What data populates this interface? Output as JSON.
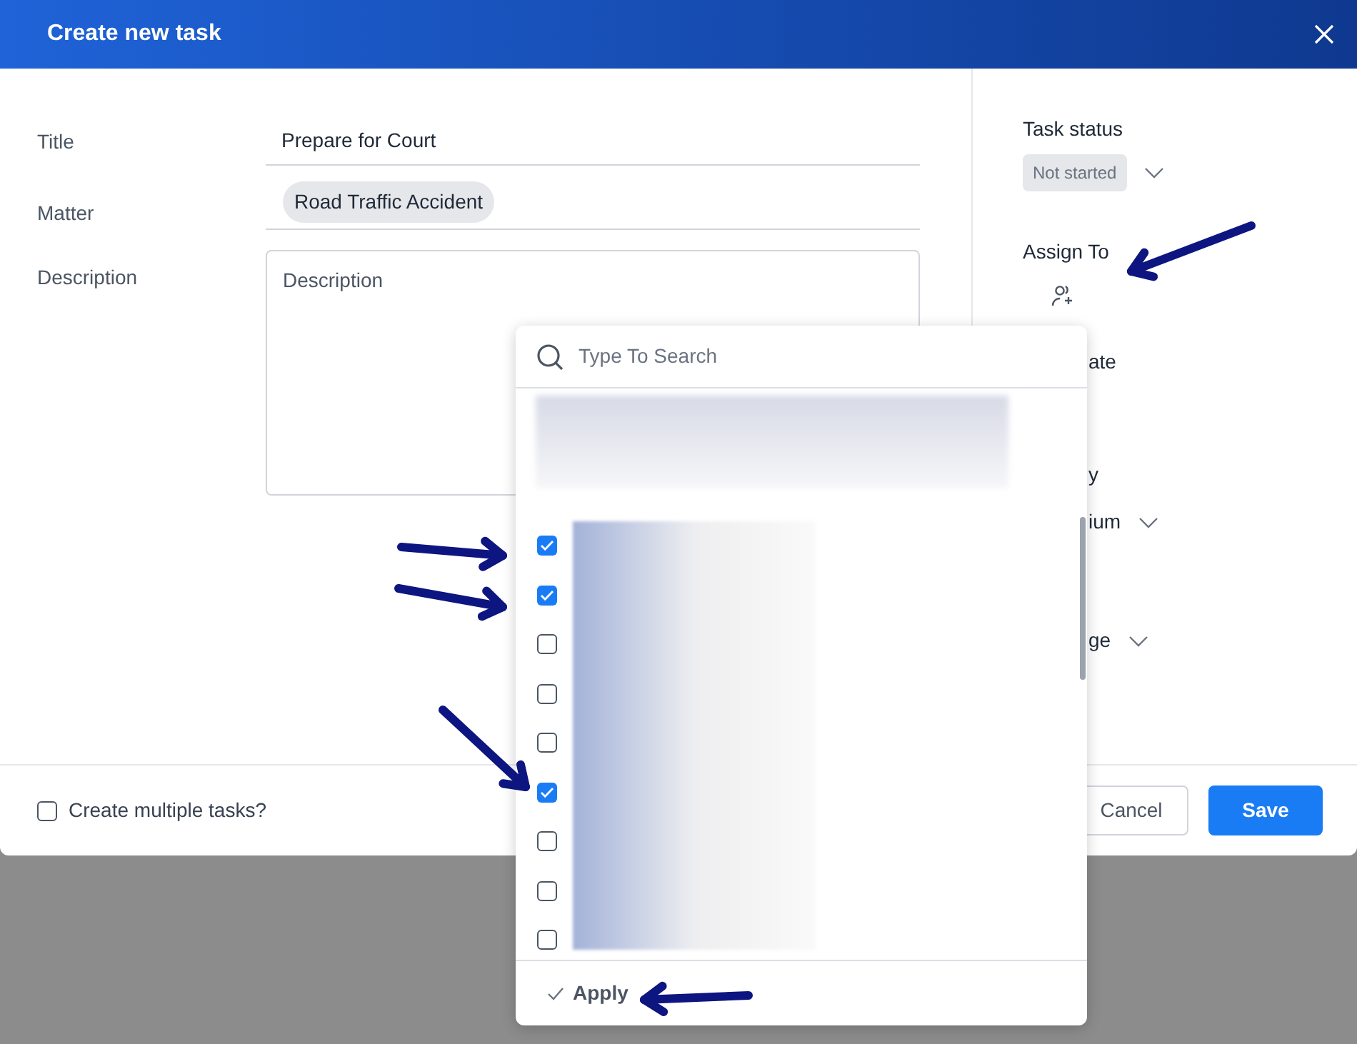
{
  "dialog": {
    "title": "Create new task"
  },
  "fields": [
    {
      "label": "Title",
      "kind": "text",
      "value": "Prepare for Court"
    },
    {
      "label": "Matter",
      "kind": "chip",
      "value": "Road Traffic Accident"
    },
    {
      "label": "Description",
      "kind": "textarea",
      "placeholder": "Description"
    }
  ],
  "side": {
    "status_label": "Task status",
    "status": "Not started",
    "assign_label": "Assign To",
    "items": [
      {
        "kind": "label",
        "text": "ate"
      },
      {
        "kind": "label",
        "text": "y"
      },
      {
        "kind": "select",
        "text": "ium"
      },
      {
        "kind": "select",
        "text": "ge"
      }
    ]
  },
  "footer": {
    "multiple": {
      "label": "Create multiple tasks?",
      "checked": false
    },
    "buttons": [
      {
        "label": "Cancel",
        "kind": "secondary"
      },
      {
        "label": "Save",
        "kind": "primary"
      }
    ]
  },
  "dropdown": {
    "placeholder": "Type To Search",
    "options": [
      {
        "checked": true
      },
      {
        "checked": true
      },
      {
        "checked": false
      },
      {
        "checked": false
      },
      {
        "checked": false
      },
      {
        "checked": true
      },
      {
        "checked": false
      },
      {
        "checked": false
      },
      {
        "checked": false
      }
    ],
    "apply": "Apply"
  }
}
